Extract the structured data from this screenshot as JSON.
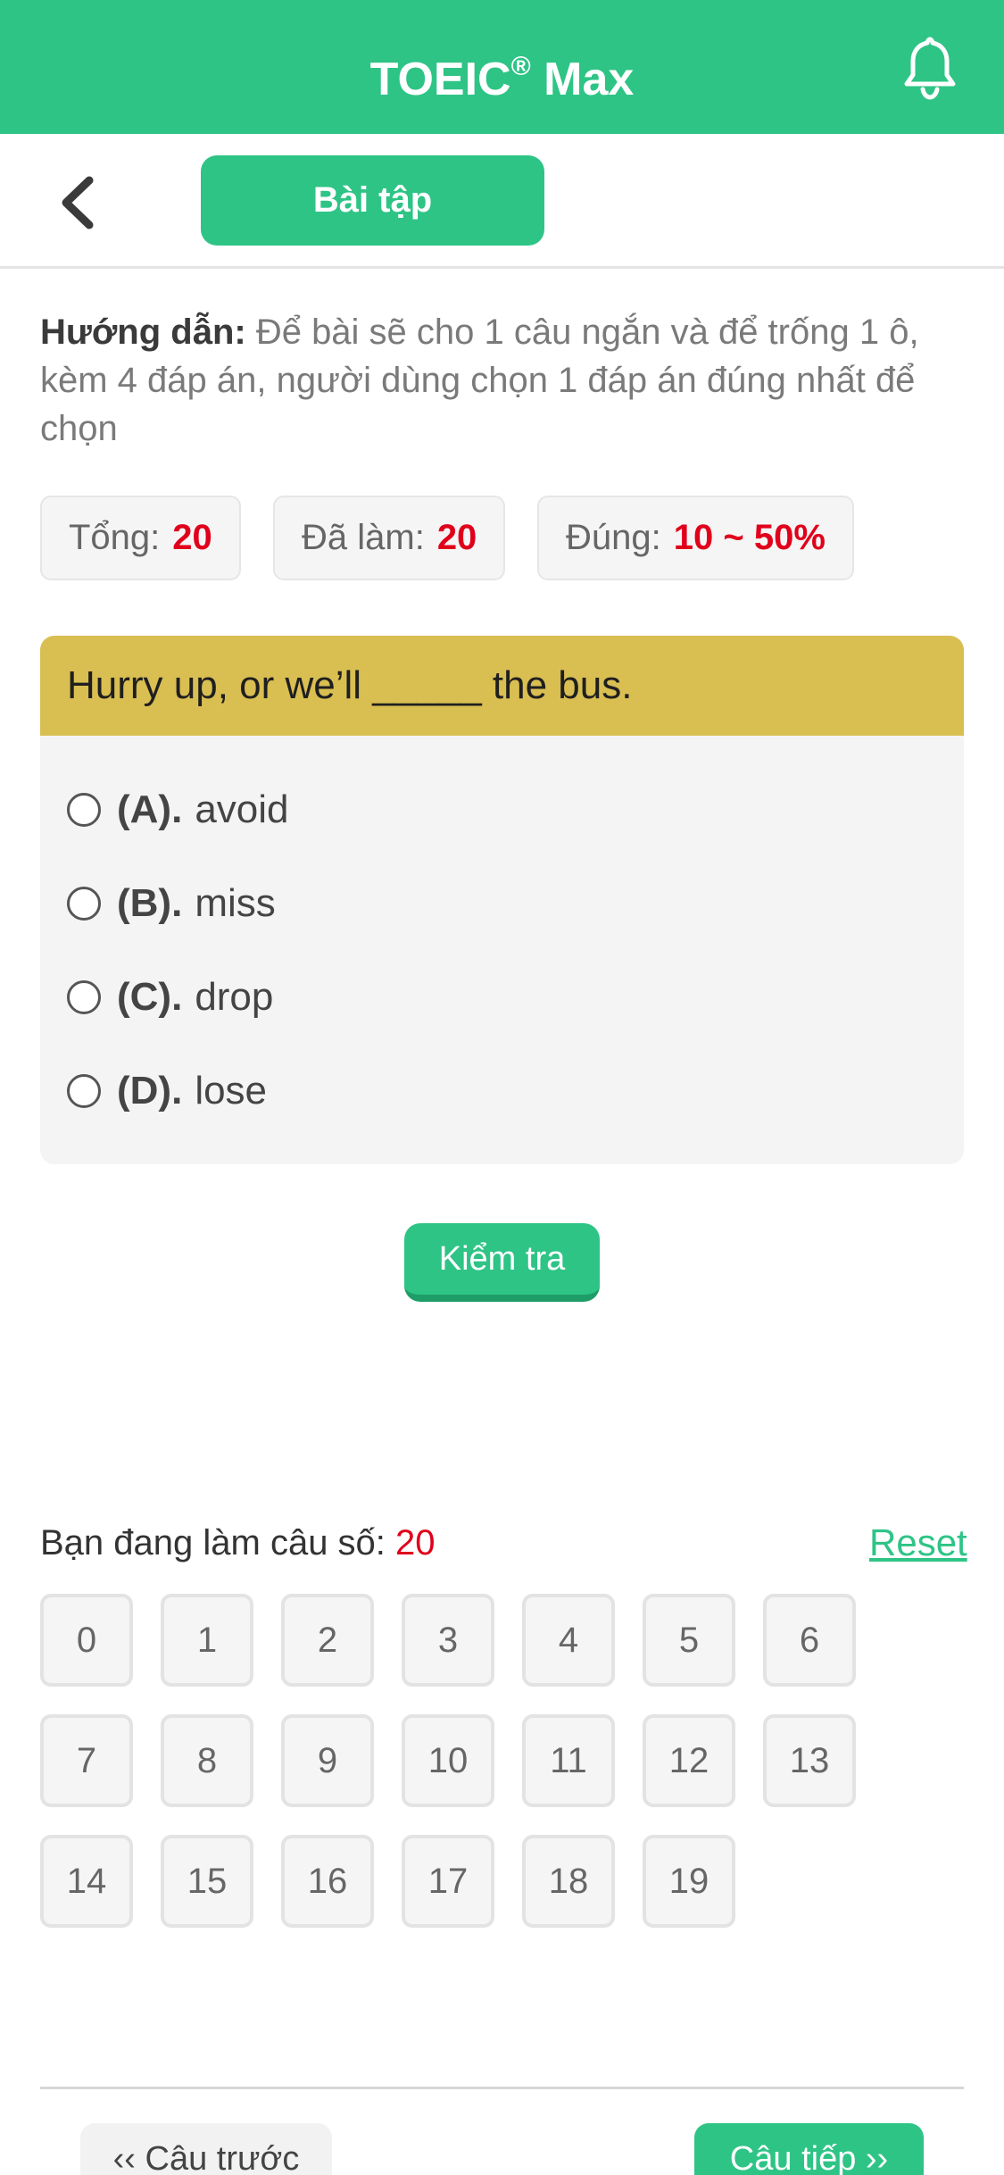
{
  "header": {
    "title": "TOEIC",
    "title_mark": "®",
    "title_suffix": " Max",
    "bell_icon": "bell-icon",
    "color": "#2ec486"
  },
  "subbar": {
    "back_icon": "chevron-left-icon",
    "tab_label": "Bài tập"
  },
  "guide": {
    "label": "Hướng dẫn:",
    "text": " Để bài sẽ cho 1 câu ngắn và để trống 1 ô, kèm 4 đáp án, người dùng chọn 1 đáp án đúng nhất để chọn"
  },
  "stats": {
    "total_label": "Tổng:",
    "total_value": "20",
    "done_label": "Đã làm:",
    "done_value": "20",
    "correct_label": "Đúng:",
    "correct_value": "10 ~ 50%"
  },
  "question": {
    "text": "Hurry up, or we’ll _____ the bus.",
    "options": [
      {
        "label": "(A).",
        "text": "avoid"
      },
      {
        "label": "(B).",
        "text": "miss"
      },
      {
        "label": "(C).",
        "text": "drop"
      },
      {
        "label": "(D).",
        "text": "lose"
      }
    ],
    "header_color": "#d9be52"
  },
  "check_button": "Kiểm tra",
  "progress": {
    "label": "Bạn đang làm câu số:",
    "value": "20",
    "reset_label": "Reset"
  },
  "question_numbers": [
    "0",
    "1",
    "2",
    "3",
    "4",
    "5",
    "6",
    "7",
    "8",
    "9",
    "10",
    "11",
    "12",
    "13",
    "14",
    "15",
    "16",
    "17",
    "18",
    "19"
  ],
  "nav": {
    "prev_label": "‹‹ Câu trước",
    "next_label": "Câu tiếp ››"
  },
  "colors": {
    "accent": "#2ec486",
    "value_red": "#e0001b"
  }
}
